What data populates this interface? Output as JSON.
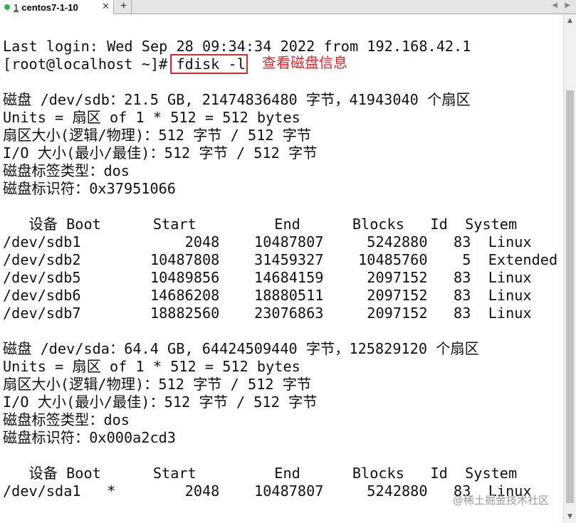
{
  "tab": {
    "number": "1",
    "title": "centos7-1-10",
    "close": "✕",
    "status_color": "#2db84b"
  },
  "new_tab": "+",
  "nav": {
    "left": "◀",
    "right": "▶"
  },
  "terminal": {
    "lines": [
      "",
      "Last login: Wed Sep 28 09:34:34 2022 from 192.168.42.1",
      "[root@localhost ~]# fdisk -l",
      "",
      "磁盘 /dev/sdb：21.5 GB, 21474836480 字节，41943040 个扇区",
      "Units = 扇区 of 1 * 512 = 512 bytes",
      "扇区大小(逻辑/物理)：512 字节 / 512 字节",
      "I/O 大小(最小/最佳)：512 字节 / 512 字节",
      "磁盘标签类型：dos",
      "磁盘标识符：0x37951066",
      "",
      "   设备 Boot      Start         End      Blocks   Id  System",
      "/dev/sdb1            2048    10487807     5242880   83  Linux",
      "/dev/sdb2        10487808    31459327    10485760    5  Extended",
      "/dev/sdb5        10489856    14684159     2097152   83  Linux",
      "/dev/sdb6        14686208    18880511     2097152   83  Linux",
      "/dev/sdb7        18882560    23076863     2097152   83  Linux",
      "",
      "磁盘 /dev/sda：64.4 GB, 64424509440 字节，125829120 个扇区",
      "Units = 扇区 of 1 * 512 = 512 bytes",
      "扇区大小(逻辑/物理)：512 字节 / 512 字节",
      "I/O 大小(最小/最佳)：512 字节 / 512 字节",
      "磁盘标签类型：dos",
      "磁盘标识符：0x000a2cd3",
      "",
      "   设备 Boot      Start         End      Blocks   Id  System",
      "/dev/sda1   *        2048    10487807     5242880   83  Linux"
    ]
  },
  "annotation": {
    "text": "查看磁盘信息",
    "color": "#d9272e"
  },
  "watermark": "@稀土掘金技术社区",
  "scrollbar": {
    "up": "▲",
    "down": "▼"
  }
}
